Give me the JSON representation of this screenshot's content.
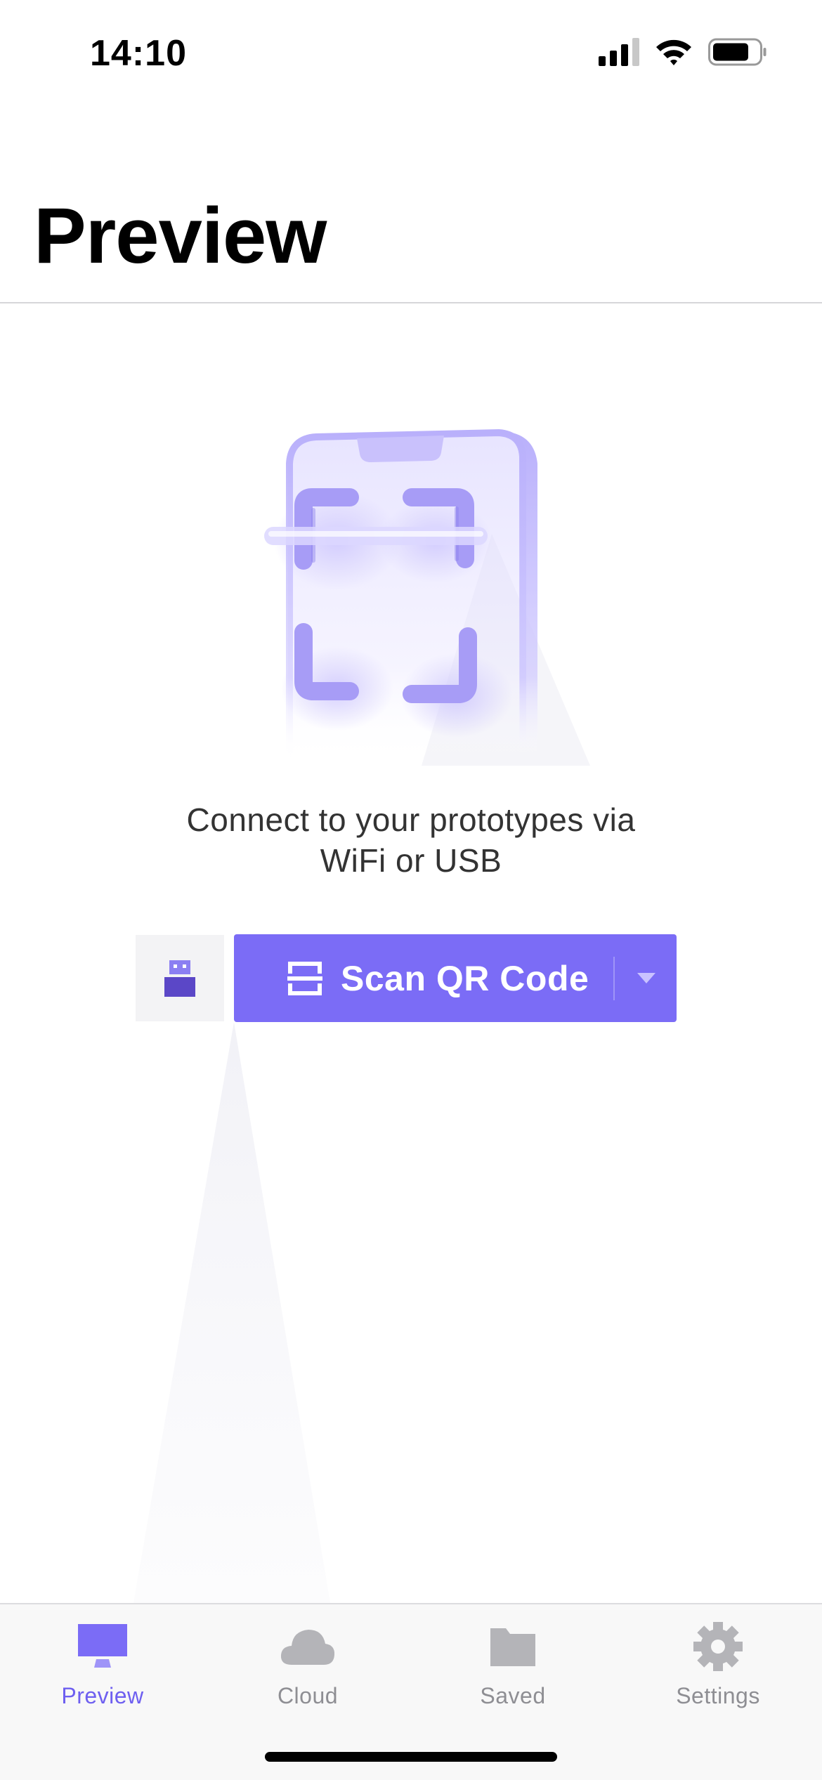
{
  "status_bar": {
    "time": "14:10"
  },
  "header": {
    "title": "Preview"
  },
  "main": {
    "subtitle_line1": "Connect to your prototypes via",
    "subtitle_line2": "WiFi or USB",
    "usb_button_icon": "usb-icon",
    "scan_button": {
      "label": "Scan QR Code",
      "icon": "qr-scan-icon",
      "dropdown_icon": "chevron-down-icon"
    }
  },
  "tab_bar": {
    "tabs": [
      {
        "label": "Preview",
        "icon": "monitor-icon",
        "active": true
      },
      {
        "label": "Cloud",
        "icon": "cloud-icon",
        "active": false
      },
      {
        "label": "Saved",
        "icon": "folder-icon",
        "active": false
      },
      {
        "label": "Settings",
        "icon": "gear-icon",
        "active": false
      }
    ]
  },
  "colors": {
    "accent": "#7b6cf6",
    "inactive": "#8e8e93",
    "usb_button_bg": "#f3f3f5"
  }
}
